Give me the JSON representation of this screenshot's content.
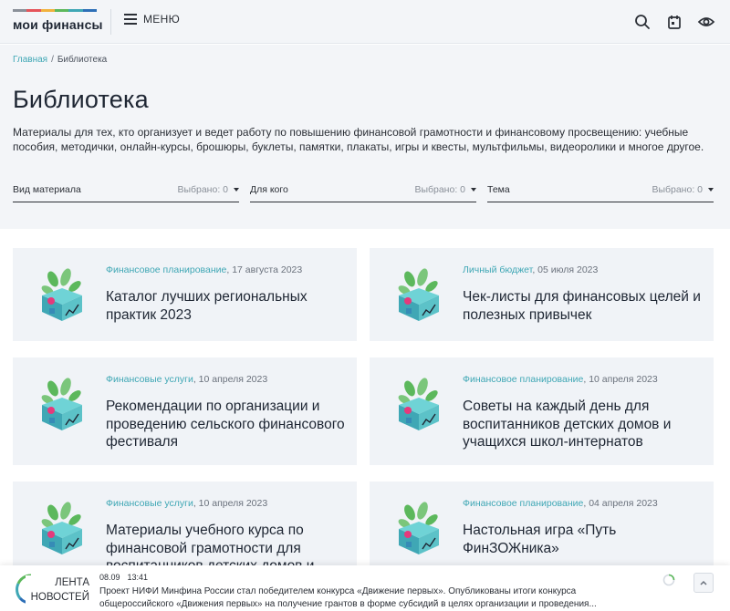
{
  "header": {
    "logo_text": "мои финансы",
    "logo_colors": [
      "#8a9099",
      "#e5545a",
      "#f1b23d",
      "#5cb85c",
      "#3fa7b5",
      "#2d6fb7"
    ],
    "menu_label": "МЕНЮ",
    "icons": [
      "search-icon",
      "calendar-icon",
      "eye-icon"
    ]
  },
  "breadcrumb": {
    "home": "Главная",
    "separator": "/",
    "current": "Библиотека"
  },
  "page": {
    "title": "Библиотека",
    "description": "Материалы для тех, кто организует и ведет работу по повышению финансовой грамотности и финансовому просвещению: учебные пособия, методички, онлайн-курсы, брошюры, буклеты, памятки, плакаты, игры и квесты, мультфильмы, видеоролики и многое другое."
  },
  "filters": [
    {
      "label": "Вид материала",
      "value": "Выбрано: 0"
    },
    {
      "label": "Для кого",
      "value": "Выбрано: 0"
    },
    {
      "label": "Тема",
      "value": "Выбрано: 0"
    }
  ],
  "cards": [
    {
      "category": "Финансовое планирование",
      "date": ", 17 августа 2023",
      "title": "Каталог лучших региональных практик 2023"
    },
    {
      "category": "Личный бюджет",
      "date": ", 05 июля 2023",
      "title": "Чек-листы для финансовых целей и полезных привычек"
    },
    {
      "category": "Финансовые услуги",
      "date": ", 10 апреля 2023",
      "title": "Рекомендации по организации и проведению сельского финансового фестиваля"
    },
    {
      "category": "Финансовое планирование",
      "date": ", 10 апреля 2023",
      "title": "Советы на каждый день для воспитанников детских домов и учащихся школ-интернатов"
    },
    {
      "category": "Финансовые услуги",
      "date": ", 10 апреля 2023",
      "title": "Материалы учебного курса по финансовой грамотности для воспитанников детских домов и"
    },
    {
      "category": "Финансовое планирование",
      "date": ", 04 апреля 2023",
      "title": "Настольная игра «Путь ФинЗОЖника»"
    }
  ],
  "ticker": {
    "label_line1": "ЛЕНТА",
    "label_line2": "НОВОСТЕЙ",
    "date": "08.09",
    "time": "13:41",
    "text": "Проект НИФИ Минфина России стал победителем конкурса «Движение первых». Опубликованы итоги конкурса общероссийского «Движения первых» на получение грантов в форме субсидий в целях организации и проведения..."
  },
  "colors": {
    "accent": "#3fa7b5",
    "hero_bg": "#f3f5f8",
    "card_bg": "#f0f3f7"
  }
}
